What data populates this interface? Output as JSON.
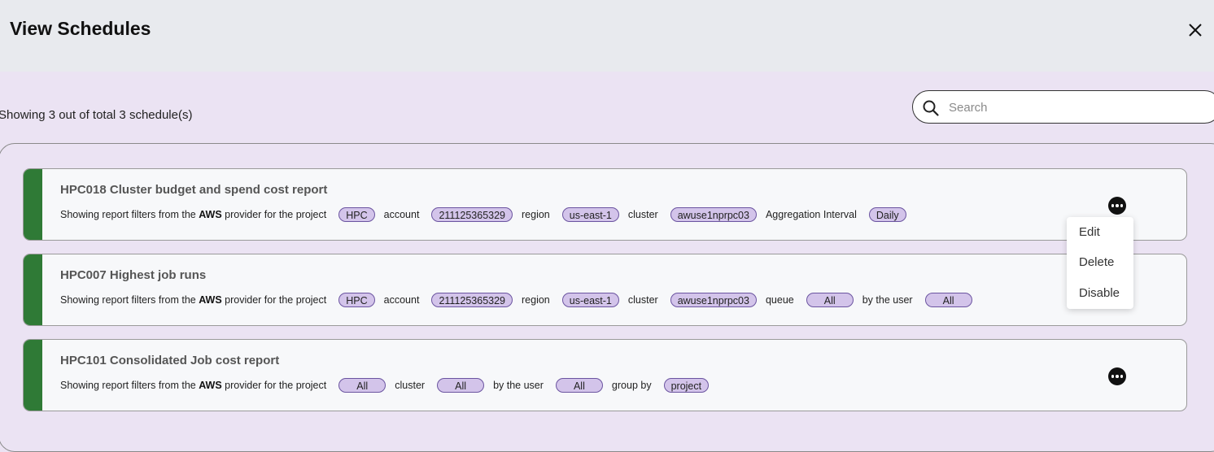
{
  "dialog": {
    "title": "View Schedules"
  },
  "summary": "Showing 3 out of total 3 schedule(s)",
  "search": {
    "placeholder": "Search",
    "value": ""
  },
  "schedules": [
    {
      "name": "HPC018 Cluster budget and spend cost report",
      "filters": [
        {
          "type": "label",
          "text": "Showing report filters from the "
        },
        {
          "type": "bold",
          "text": "AWS"
        },
        {
          "type": "label",
          "text": " provider for the project"
        },
        {
          "type": "chip",
          "text": "HPC"
        },
        {
          "type": "label",
          "text": "account"
        },
        {
          "type": "chip",
          "text": "211125365329"
        },
        {
          "type": "label",
          "text": "region"
        },
        {
          "type": "chip",
          "text": "us-east-1"
        },
        {
          "type": "label",
          "text": "cluster"
        },
        {
          "type": "chip",
          "text": "awuse1nprpc03"
        },
        {
          "type": "label",
          "text": "Aggregation Interval"
        },
        {
          "type": "chip",
          "text": "Daily"
        }
      ],
      "has_menu_button": true
    },
    {
      "name": "HPC007 Highest job runs",
      "filters": [
        {
          "type": "label",
          "text": "Showing report filters from the "
        },
        {
          "type": "bold",
          "text": "AWS"
        },
        {
          "type": "label",
          "text": " provider for the project"
        },
        {
          "type": "chip",
          "text": "HPC"
        },
        {
          "type": "label",
          "text": "account"
        },
        {
          "type": "chip",
          "text": "211125365329"
        },
        {
          "type": "label",
          "text": "region"
        },
        {
          "type": "chip",
          "text": "us-east-1"
        },
        {
          "type": "label",
          "text": "cluster"
        },
        {
          "type": "chip",
          "text": "awuse1nprpc03"
        },
        {
          "type": "label",
          "text": "queue"
        },
        {
          "type": "chip",
          "text": "All",
          "wide": true
        },
        {
          "type": "label",
          "text": "by the user"
        },
        {
          "type": "chip",
          "text": "All",
          "wide": true
        }
      ],
      "has_menu_button": false
    },
    {
      "name": "HPC101 Consolidated Job cost report",
      "filters": [
        {
          "type": "label",
          "text": "Showing report filters from the "
        },
        {
          "type": "bold",
          "text": "AWS"
        },
        {
          "type": "label",
          "text": " provider for the project"
        },
        {
          "type": "chip",
          "text": "All",
          "wide": true
        },
        {
          "type": "label",
          "text": "cluster"
        },
        {
          "type": "chip",
          "text": "All",
          "wide": true
        },
        {
          "type": "label",
          "text": "by the user"
        },
        {
          "type": "chip",
          "text": "All",
          "wide": true
        },
        {
          "type": "label",
          "text": "group by"
        },
        {
          "type": "chip",
          "text": "project"
        }
      ],
      "has_menu_button": true
    }
  ],
  "context_menu": {
    "items": [
      "Edit",
      "Delete",
      "Disable"
    ]
  },
  "colors": {
    "accent_stripe": "#2f7a36",
    "chip_fill": "#d3c4ea",
    "chip_border": "#6b54a0",
    "background": "#ebe3f3",
    "header": "#e8eaee"
  },
  "icons": {
    "close": "close-icon",
    "search": "search-icon",
    "more": "more-options-icon"
  }
}
